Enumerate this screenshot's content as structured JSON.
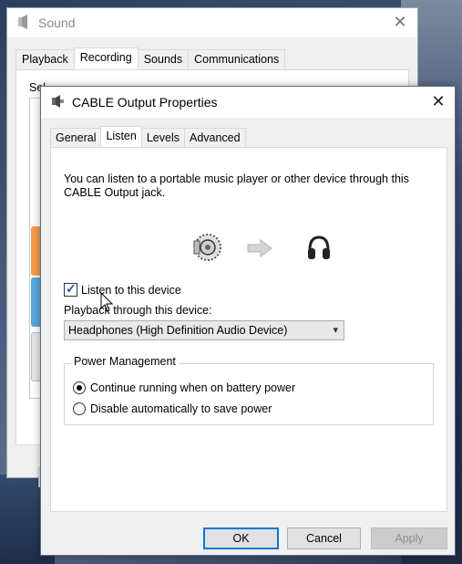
{
  "sound_window": {
    "title": "Sound",
    "close_glyph": "✕",
    "tabs": [
      {
        "label": "Playback"
      },
      {
        "label": "Recording"
      },
      {
        "label": "Sounds"
      },
      {
        "label": "Communications"
      }
    ],
    "active_tab": "Recording",
    "partial_text": "Sel"
  },
  "dialog": {
    "title": "CABLE Output Properties",
    "close_glyph": "✕",
    "tabs": [
      {
        "label": "General"
      },
      {
        "label": "Listen"
      },
      {
        "label": "Levels"
      },
      {
        "label": "Advanced"
      }
    ],
    "active_tab": "Listen",
    "description": "You can listen to a portable music player or other device through this CABLE Output jack.",
    "listen_checkbox": {
      "label": "Listen to this device",
      "checked": true
    },
    "playback_label": "Playback through this device:",
    "playback_select": {
      "value": "Headphones (High Definition Audio Device)"
    },
    "power_group": {
      "legend": "Power Management",
      "options": [
        {
          "label": "Continue running when on battery power",
          "selected": true
        },
        {
          "label": "Disable automatically to save power",
          "selected": false
        }
      ]
    },
    "buttons": {
      "ok": "OK",
      "cancel": "Cancel",
      "apply": "Apply"
    }
  },
  "icons": {
    "speaker_icon": "speaker-icon",
    "arrow_icon": "arrow-right-icon",
    "headphones_icon": "headphones-icon"
  },
  "colors": {
    "accent": "#0078d7",
    "checkbox_check": "#1a5fb4",
    "disabled_text": "#8d8d8d"
  }
}
